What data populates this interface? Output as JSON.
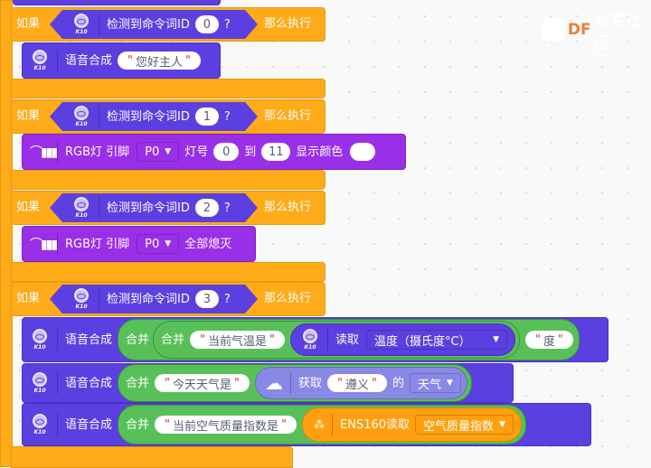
{
  "watermark": {
    "brand": "DF",
    "title": "创客社区",
    "url": "mc.DFRobot.com.cn"
  },
  "common": {
    "if_label": "如果",
    "then_label": "那么执行",
    "detect_label": "检测到命令词ID",
    "question": "?",
    "k10_label": "K10",
    "tts_label": "语音合成",
    "merge_label": "合并",
    "quote": "\""
  },
  "blocks": [
    {
      "cmd_id": "0",
      "actions": [
        {
          "type": "tts",
          "text": "您好主人"
        }
      ]
    },
    {
      "cmd_id": "1",
      "actions": [
        {
          "type": "rgb_range",
          "label": "RGB灯 引脚",
          "pin": "P0",
          "num_label": "灯号",
          "from": "0",
          "to_label": "到",
          "to": "11",
          "color_label": "显示颜色",
          "color": "#ffffff"
        }
      ]
    },
    {
      "cmd_id": "2",
      "actions": [
        {
          "type": "rgb_off",
          "label": "RGB灯 引脚",
          "pin": "P0",
          "off_label": "全部熄灭"
        }
      ]
    },
    {
      "cmd_id": "3",
      "actions": [
        {
          "type": "tts_temp",
          "text1": "当前气温是",
          "read_label": "读取",
          "sensor": "温度（摄氏度°C）",
          "text2": "度"
        },
        {
          "type": "tts_weather",
          "text1": "今天天气是",
          "get_label": "获取",
          "city": "遵义",
          "of_label": "的",
          "field": "天气"
        },
        {
          "type": "tts_air",
          "text1": "当前空气质量指数是",
          "ens_label": "ENS160读取",
          "field": "空气质量指数"
        }
      ]
    }
  ]
}
